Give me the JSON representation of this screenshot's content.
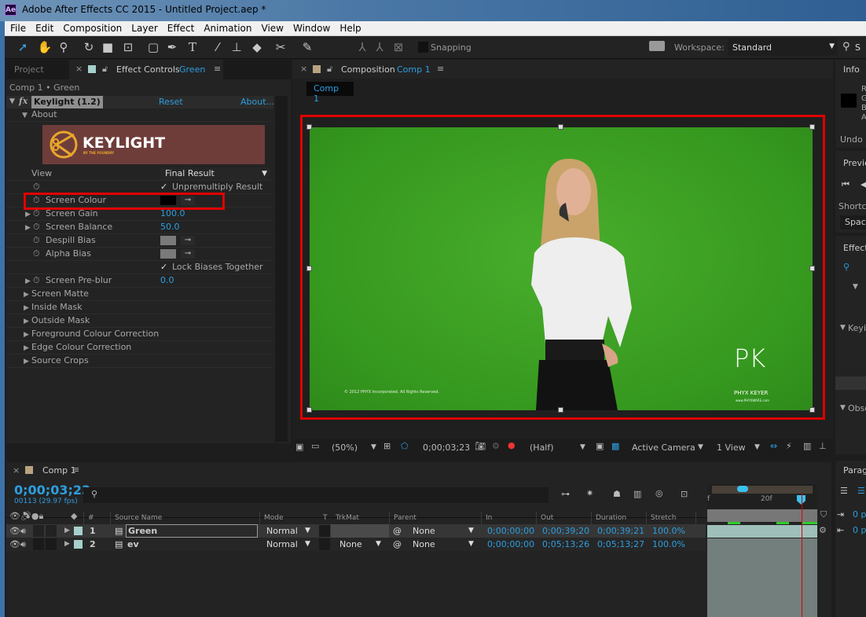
{
  "window": {
    "app_icon": "Ae",
    "title": "Adobe After Effects CC 2015 - Untitled Project.aep *"
  },
  "menu": [
    "File",
    "Edit",
    "Composition",
    "Layer",
    "Effect",
    "Animation",
    "View",
    "Window",
    "Help"
  ],
  "toolbar": {
    "tools": [
      "selection-tool",
      "hand-tool",
      "zoom-tool",
      "rotate-tool",
      "camera-tool",
      "pan-behind-tool",
      "rectangle-tool",
      "pen-tool",
      "type-tool",
      "brush-tool",
      "clone-stamp-tool",
      "eraser-tool",
      "roto-brush-tool",
      "puppet-pin-tool"
    ],
    "snapping": "Snapping",
    "workspace_label": "Workspace:",
    "workspace_value": "Standard",
    "search_partial": "S"
  },
  "left_panel": {
    "tab_project": "Project",
    "tab_effect_controls": "Effect Controls",
    "tab_effect_layer": "Green",
    "breadcrumb": "Comp 1 • Green",
    "effect": {
      "name": "Keylight (1.2)",
      "reset": "Reset",
      "about": "About...",
      "about_group": "About",
      "logo_text": "KEYLIGHT",
      "logo_sub": "BY THE FOUNDRY"
    },
    "view_label": "View",
    "view_value": "Final Result",
    "unpremultiply": "Unpremultiply Result",
    "screen_colour": "Screen Colour",
    "screen_colour_value": "#000000",
    "screen_gain": "Screen Gain",
    "screen_gain_value": "100.0",
    "screen_balance": "Screen Balance",
    "screen_balance_value": "50.0",
    "despill_bias": "Despill Bias",
    "alpha_bias": "Alpha Bias",
    "bias_color": "#7a7a7a",
    "lock_biases": "Lock Biases Together",
    "screen_preblur": "Screen Pre-blur",
    "screen_preblur_value": "0.0",
    "groups": [
      "Screen Matte",
      "Inside Mask",
      "Outside Mask",
      "Foreground Colour Correction",
      "Edge Colour Correction",
      "Source Crops"
    ]
  },
  "comp_panel": {
    "tab_label": "Composition",
    "tab_comp": "Comp 1",
    "sub_tab": "Comp 1",
    "footage_copyright": "© 2012 PHYX Incorporated.  All Rights Reserved.",
    "footage_logo": "PK",
    "footage_logo_text": "PHYX KEYER",
    "footage_url": "www.PHYXWARE.com",
    "zoom": "(50%)",
    "timecode": "0;00;03;23",
    "resolution": "(Half)",
    "camera": "Active Camera",
    "views": "1 View",
    "highlight_color": "#e00000"
  },
  "timeline": {
    "tab": "Comp 1",
    "timecode": "0;00;03;23",
    "frame_info": "00113 (29.97 fps)",
    "columns": {
      "num": "#",
      "source": "Source Name",
      "mode": "Mode",
      "t": "T",
      "trkmat": "TrkMat",
      "parent": "Parent",
      "in": "In",
      "out": "Out",
      "duration": "Duration",
      "stretch": "Stretch"
    },
    "ruler_label": "20f",
    "ruler_start": "f",
    "layers": [
      {
        "num": "1",
        "name": "Green",
        "mode": "Normal",
        "trkmat": "",
        "parent": "None",
        "in": "0;00;00;00",
        "out": "0;00;39;20",
        "duration": "0;00;39;21",
        "stretch": "100.0%",
        "color": "#a6d0cc"
      },
      {
        "num": "2",
        "name": "ev",
        "mode": "Normal",
        "trkmat": "None",
        "parent": "None",
        "in": "0;00;00;00",
        "out": "0;05;13;26",
        "duration": "0;05;13;27",
        "stretch": "100.0%",
        "color": "#a6d0cc"
      }
    ]
  },
  "right_panels": {
    "info": "Info",
    "rgba": [
      "R",
      "G",
      "B",
      "A"
    ],
    "undo": "Undo",
    "preview": "Previe",
    "shortcut": "Shortcu",
    "shortcut_value": "Space",
    "effects": "Effect",
    "keying": "Keyin",
    "obsolete": "Obso",
    "paragraph": "Parag",
    "indent1": "0 p",
    "indent2": "0 p"
  }
}
